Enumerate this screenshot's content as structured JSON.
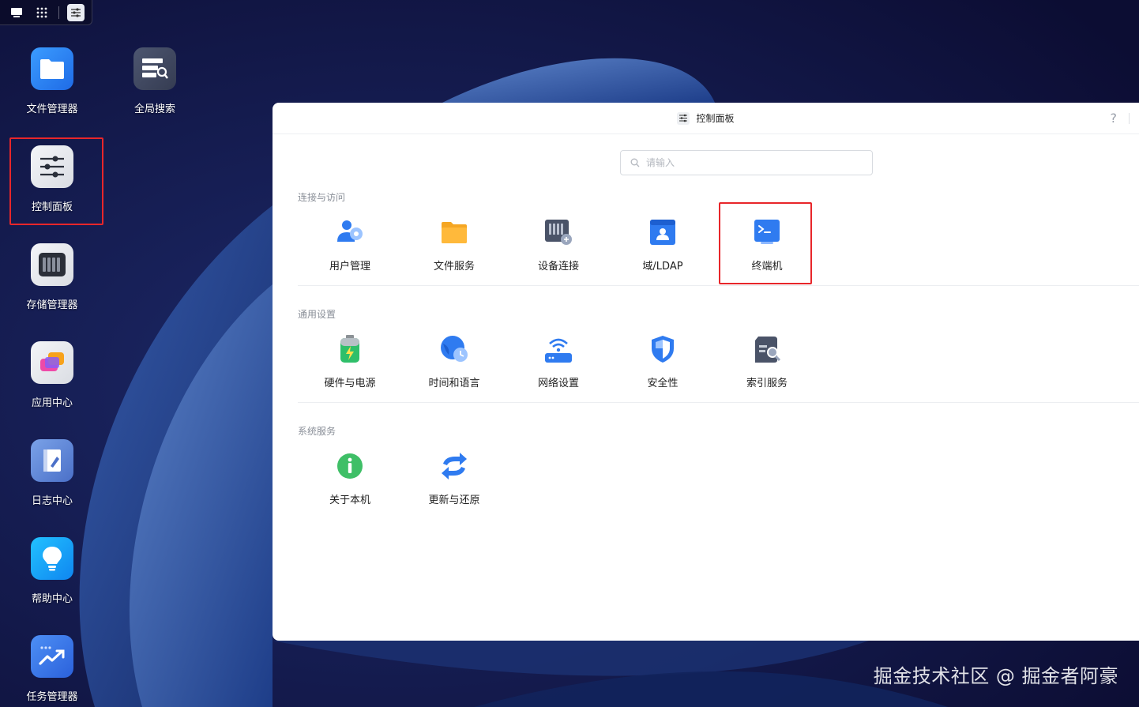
{
  "desktop": {
    "icons": [
      {
        "label": "文件管理器",
        "icon": "folder-icon"
      },
      {
        "label": "全局搜索",
        "icon": "global-search-icon"
      },
      {
        "label": "控制面板",
        "icon": "control-panel-icon"
      },
      {
        "label": "存储管理器",
        "icon": "storage-icon"
      },
      {
        "label": "应用中心",
        "icon": "app-center-icon"
      },
      {
        "label": "日志中心",
        "icon": "log-center-icon"
      },
      {
        "label": "帮助中心",
        "icon": "help-bulb-icon"
      },
      {
        "label": "任务管理器",
        "icon": "task-manager-icon"
      }
    ]
  },
  "window": {
    "title": "控制面板",
    "help": "?",
    "search_placeholder": "请输入",
    "sections": [
      {
        "title": "连接与访问",
        "items": [
          {
            "label": "用户管理",
            "icon": "user-management-icon"
          },
          {
            "label": "文件服务",
            "icon": "file-service-icon"
          },
          {
            "label": "设备连接",
            "icon": "device-connection-icon"
          },
          {
            "label": "域/LDAP",
            "icon": "domain-ldap-icon"
          },
          {
            "label": "终端机",
            "icon": "terminal-icon"
          }
        ]
      },
      {
        "title": "通用设置",
        "items": [
          {
            "label": "硬件与电源",
            "icon": "hardware-power-icon"
          },
          {
            "label": "时间和语言",
            "icon": "time-language-icon"
          },
          {
            "label": "网络设置",
            "icon": "network-icon"
          },
          {
            "label": "安全性",
            "icon": "security-shield-icon"
          },
          {
            "label": "索引服务",
            "icon": "index-service-icon"
          }
        ]
      },
      {
        "title": "系统服务",
        "items": [
          {
            "label": "关于本机",
            "icon": "info-icon"
          },
          {
            "label": "更新与还原",
            "icon": "update-restore-icon"
          }
        ]
      }
    ]
  },
  "watermark": "掘金技术社区 @ 掘金者阿豪",
  "colors": {
    "highlight": "#e8262a",
    "accent": "#3a7bf2"
  }
}
